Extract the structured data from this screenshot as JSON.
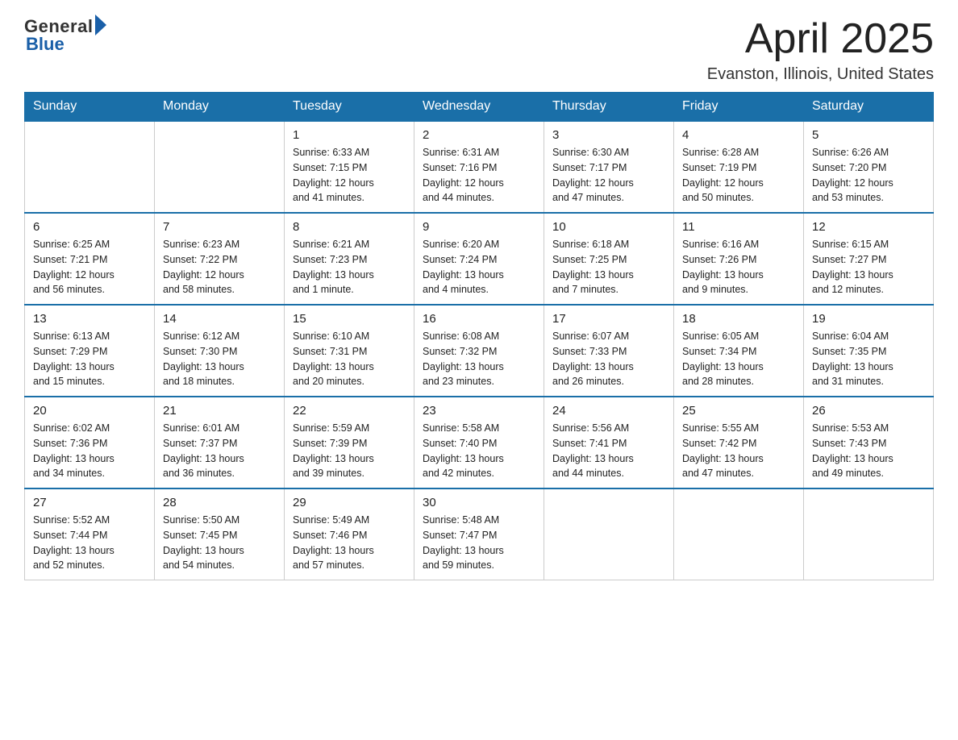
{
  "logo": {
    "general": "General",
    "blue": "Blue"
  },
  "header": {
    "month": "April 2025",
    "location": "Evanston, Illinois, United States"
  },
  "weekdays": [
    "Sunday",
    "Monday",
    "Tuesday",
    "Wednesday",
    "Thursday",
    "Friday",
    "Saturday"
  ],
  "weeks": [
    [
      {
        "day": "",
        "info": ""
      },
      {
        "day": "",
        "info": ""
      },
      {
        "day": "1",
        "info": "Sunrise: 6:33 AM\nSunset: 7:15 PM\nDaylight: 12 hours\nand 41 minutes."
      },
      {
        "day": "2",
        "info": "Sunrise: 6:31 AM\nSunset: 7:16 PM\nDaylight: 12 hours\nand 44 minutes."
      },
      {
        "day": "3",
        "info": "Sunrise: 6:30 AM\nSunset: 7:17 PM\nDaylight: 12 hours\nand 47 minutes."
      },
      {
        "day": "4",
        "info": "Sunrise: 6:28 AM\nSunset: 7:19 PM\nDaylight: 12 hours\nand 50 minutes."
      },
      {
        "day": "5",
        "info": "Sunrise: 6:26 AM\nSunset: 7:20 PM\nDaylight: 12 hours\nand 53 minutes."
      }
    ],
    [
      {
        "day": "6",
        "info": "Sunrise: 6:25 AM\nSunset: 7:21 PM\nDaylight: 12 hours\nand 56 minutes."
      },
      {
        "day": "7",
        "info": "Sunrise: 6:23 AM\nSunset: 7:22 PM\nDaylight: 12 hours\nand 58 minutes."
      },
      {
        "day": "8",
        "info": "Sunrise: 6:21 AM\nSunset: 7:23 PM\nDaylight: 13 hours\nand 1 minute."
      },
      {
        "day": "9",
        "info": "Sunrise: 6:20 AM\nSunset: 7:24 PM\nDaylight: 13 hours\nand 4 minutes."
      },
      {
        "day": "10",
        "info": "Sunrise: 6:18 AM\nSunset: 7:25 PM\nDaylight: 13 hours\nand 7 minutes."
      },
      {
        "day": "11",
        "info": "Sunrise: 6:16 AM\nSunset: 7:26 PM\nDaylight: 13 hours\nand 9 minutes."
      },
      {
        "day": "12",
        "info": "Sunrise: 6:15 AM\nSunset: 7:27 PM\nDaylight: 13 hours\nand 12 minutes."
      }
    ],
    [
      {
        "day": "13",
        "info": "Sunrise: 6:13 AM\nSunset: 7:29 PM\nDaylight: 13 hours\nand 15 minutes."
      },
      {
        "day": "14",
        "info": "Sunrise: 6:12 AM\nSunset: 7:30 PM\nDaylight: 13 hours\nand 18 minutes."
      },
      {
        "day": "15",
        "info": "Sunrise: 6:10 AM\nSunset: 7:31 PM\nDaylight: 13 hours\nand 20 minutes."
      },
      {
        "day": "16",
        "info": "Sunrise: 6:08 AM\nSunset: 7:32 PM\nDaylight: 13 hours\nand 23 minutes."
      },
      {
        "day": "17",
        "info": "Sunrise: 6:07 AM\nSunset: 7:33 PM\nDaylight: 13 hours\nand 26 minutes."
      },
      {
        "day": "18",
        "info": "Sunrise: 6:05 AM\nSunset: 7:34 PM\nDaylight: 13 hours\nand 28 minutes."
      },
      {
        "day": "19",
        "info": "Sunrise: 6:04 AM\nSunset: 7:35 PM\nDaylight: 13 hours\nand 31 minutes."
      }
    ],
    [
      {
        "day": "20",
        "info": "Sunrise: 6:02 AM\nSunset: 7:36 PM\nDaylight: 13 hours\nand 34 minutes."
      },
      {
        "day": "21",
        "info": "Sunrise: 6:01 AM\nSunset: 7:37 PM\nDaylight: 13 hours\nand 36 minutes."
      },
      {
        "day": "22",
        "info": "Sunrise: 5:59 AM\nSunset: 7:39 PM\nDaylight: 13 hours\nand 39 minutes."
      },
      {
        "day": "23",
        "info": "Sunrise: 5:58 AM\nSunset: 7:40 PM\nDaylight: 13 hours\nand 42 minutes."
      },
      {
        "day": "24",
        "info": "Sunrise: 5:56 AM\nSunset: 7:41 PM\nDaylight: 13 hours\nand 44 minutes."
      },
      {
        "day": "25",
        "info": "Sunrise: 5:55 AM\nSunset: 7:42 PM\nDaylight: 13 hours\nand 47 minutes."
      },
      {
        "day": "26",
        "info": "Sunrise: 5:53 AM\nSunset: 7:43 PM\nDaylight: 13 hours\nand 49 minutes."
      }
    ],
    [
      {
        "day": "27",
        "info": "Sunrise: 5:52 AM\nSunset: 7:44 PM\nDaylight: 13 hours\nand 52 minutes."
      },
      {
        "day": "28",
        "info": "Sunrise: 5:50 AM\nSunset: 7:45 PM\nDaylight: 13 hours\nand 54 minutes."
      },
      {
        "day": "29",
        "info": "Sunrise: 5:49 AM\nSunset: 7:46 PM\nDaylight: 13 hours\nand 57 minutes."
      },
      {
        "day": "30",
        "info": "Sunrise: 5:48 AM\nSunset: 7:47 PM\nDaylight: 13 hours\nand 59 minutes."
      },
      {
        "day": "",
        "info": ""
      },
      {
        "day": "",
        "info": ""
      },
      {
        "day": "",
        "info": ""
      }
    ]
  ]
}
